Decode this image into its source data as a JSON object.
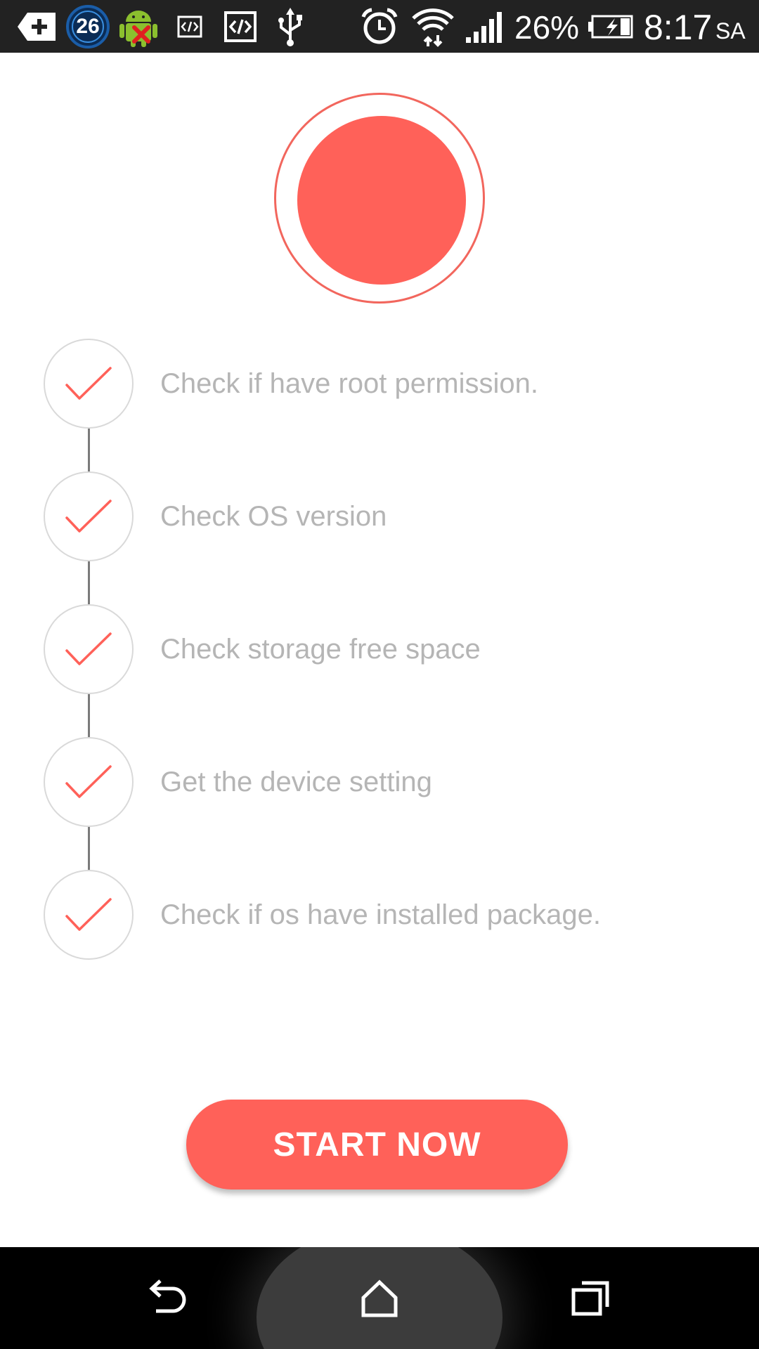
{
  "status_bar": {
    "notification_count": "26",
    "battery_percent": "26%",
    "time": "8:17",
    "time_suffix": "SA",
    "icons": [
      "add-notification-icon",
      "count-badge-icon",
      "android-error-icon",
      "code-small-icon",
      "code-icon",
      "usb-icon",
      "alarm-icon",
      "wifi-icon",
      "signal-icon",
      "battery-charging-icon"
    ]
  },
  "record_button": {
    "icon": "record-circle",
    "color": "#ff6159"
  },
  "checklist": {
    "items": [
      {
        "label": "Check if have root permission.",
        "icon": "check-icon"
      },
      {
        "label": "Check OS version",
        "icon": "check-icon"
      },
      {
        "label": "Check storage free space",
        "icon": "check-icon"
      },
      {
        "label": "Get the device setting",
        "icon": "check-icon"
      },
      {
        "label": "Check if os have installed package.",
        "icon": "check-icon"
      }
    ]
  },
  "start_button": {
    "label": "START NOW"
  },
  "nav_bar": {
    "icons": [
      "back-icon",
      "home-icon",
      "recent-apps-icon"
    ]
  },
  "colors": {
    "accent": "#ff6159",
    "status_bar": "#222222",
    "label_text": "#b5b5b5",
    "nav_bar": "#000000"
  }
}
